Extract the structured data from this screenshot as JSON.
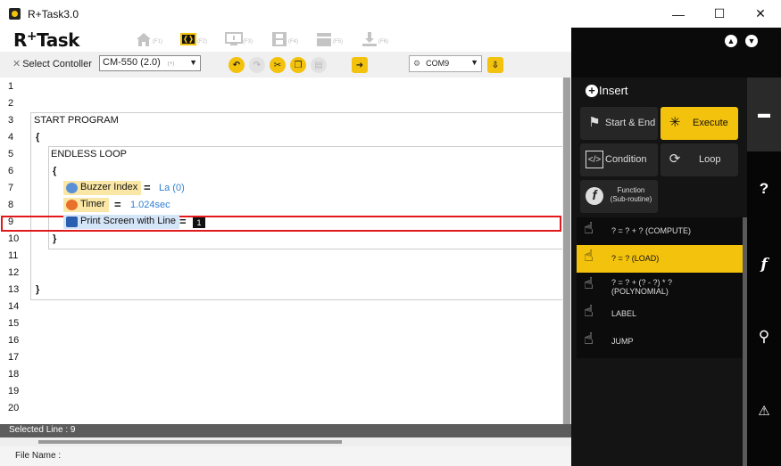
{
  "window": {
    "title": "R+Task3.0",
    "minimize": "—",
    "maximize": "☐",
    "close": "✕"
  },
  "logo": {
    "text_main": "R",
    "text_sup": "+",
    "text_tail": "Task"
  },
  "toolbar": {
    "tabs": [
      {
        "name": "home",
        "key": "(F1)"
      },
      {
        "name": "task-code",
        "key": "(F2)"
      },
      {
        "name": "monitor",
        "key": "(F3)"
      },
      {
        "name": "motion",
        "key": "(F4)"
      },
      {
        "name": "clapboard",
        "key": "(F5)"
      },
      {
        "name": "download",
        "key": "(F6)"
      }
    ],
    "controller_label": "Select Contoller",
    "controller_value": "CM-550 (2.0)",
    "controller_key": "(+)",
    "com_port": "COM9"
  },
  "editor": {
    "line_numbers": [
      "1",
      "2",
      "3",
      "4",
      "5",
      "6",
      "7",
      "8",
      "9",
      "10",
      "11",
      "12",
      "13",
      "14",
      "15",
      "16",
      "17",
      "18",
      "19",
      "20"
    ],
    "start_program": "START PROGRAM",
    "open_brace": "{",
    "close_brace": "}",
    "endless_loop": "ENDLESS LOOP",
    "buzzer_label": "Buzzer Index",
    "buzzer_value": "La (0)",
    "timer_label": "Timer",
    "timer_value": "1.024sec",
    "print_label": "Print Screen with Line",
    "print_value": "1",
    "equals": "="
  },
  "status": {
    "selected_line": "Selected Line : 9",
    "file_name": "File Name :"
  },
  "insert_panel": {
    "title": "Insert",
    "categories": [
      {
        "label": "Start & End",
        "active": false
      },
      {
        "label": "Execute",
        "active": true
      },
      {
        "label": "Condition",
        "active": false
      },
      {
        "label": "Loop",
        "active": false
      },
      {
        "label": "Function\n(Sub-routine)",
        "active": false
      }
    ],
    "commands": [
      {
        "label": "? = ? + ?  (COMPUTE)",
        "active": false
      },
      {
        "label": "? = ?  (LOAD)",
        "active": true
      },
      {
        "label": "? = ? + (? - ?) * ?",
        "label2": "(POLYNOMIAL)",
        "active": false
      },
      {
        "label": "LABEL",
        "active": false
      },
      {
        "label": "JUMP",
        "active": false
      }
    ]
  },
  "sidebar_icons": [
    "chat-icon",
    "help-icon",
    "function-icon",
    "search-icon",
    "warning-icon"
  ],
  "colors": {
    "accent": "#f3c20c",
    "panel": "#141414",
    "selection": "#e0191c",
    "value_blue": "#2e7fd4"
  }
}
